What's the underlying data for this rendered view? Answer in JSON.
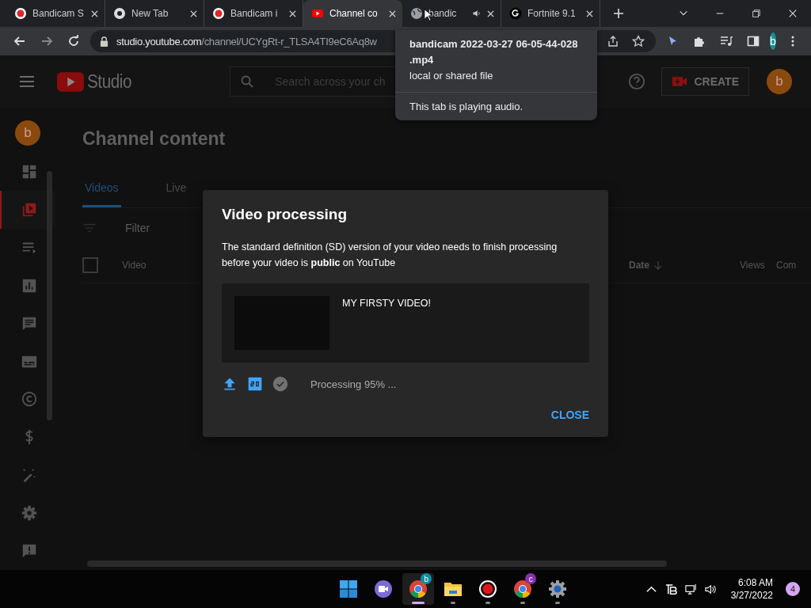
{
  "browser": {
    "tabs": [
      {
        "title": "Bandicam S",
        "kind": "record",
        "selected": false,
        "audio": false
      },
      {
        "title": "New Tab",
        "kind": "chrome",
        "selected": false,
        "audio": false
      },
      {
        "title": "Bandicam i",
        "kind": "record",
        "selected": false,
        "audio": false
      },
      {
        "title": "Channel co",
        "kind": "youtube",
        "selected": true,
        "audio": false
      },
      {
        "title": "bandic",
        "kind": "globe",
        "selected": false,
        "audio": true
      },
      {
        "title": "Fortnite 9.1",
        "kind": "letter",
        "selected": false,
        "audio": false
      }
    ],
    "address": {
      "host": "studio.youtube.com",
      "path": "/channel/UCYgRt-r_TLSA4TI9eC6Aq8w"
    },
    "profile": "b"
  },
  "tooltip": {
    "title": "bandicam 2022-03-27 06-05-44-028 .mp4",
    "subtitle": "local or shared file",
    "note": "This tab is playing audio."
  },
  "header": {
    "logo": "Studio",
    "search_placeholder": "Search across your ch",
    "create": "CREATE",
    "avatar": "b"
  },
  "sidebar": {
    "avatar": "b",
    "items": [
      {
        "kind": "dashboard",
        "selected": false
      },
      {
        "kind": "content",
        "selected": true
      },
      {
        "kind": "playlists",
        "selected": false
      },
      {
        "kind": "analytics",
        "selected": false
      },
      {
        "kind": "comments",
        "selected": false
      },
      {
        "kind": "subtitles",
        "selected": false
      },
      {
        "kind": "copyright",
        "selected": false
      },
      {
        "kind": "earn",
        "selected": false
      },
      {
        "kind": "customization",
        "selected": false
      },
      {
        "kind": "settings",
        "selected": false
      },
      {
        "kind": "feedback",
        "selected": false
      }
    ]
  },
  "content": {
    "title": "Channel content",
    "tabs": [
      {
        "label": "Videos",
        "selected": true
      },
      {
        "label": "Live",
        "selected": false
      }
    ],
    "filter": "Filter",
    "select_all": {
      "checked": false
    },
    "columns": [
      {
        "label": "Video",
        "sorted": false
      },
      {
        "label": "Date",
        "sorted": true
      },
      {
        "label": "Views",
        "sorted": false
      },
      {
        "label": "Com",
        "sorted": false
      }
    ]
  },
  "dialog": {
    "title": "Video processing",
    "message": "The standard definition (SD) version of your video needs to finish processing before your video is **public** on YouTube",
    "video_title": "MY FIRSTY VIDEO!",
    "steps": [
      {
        "kind": "upload",
        "done": true
      },
      {
        "kind": "sd",
        "done": true
      },
      {
        "kind": "check",
        "done": false
      }
    ],
    "status": "Processing 95% ...",
    "close": "CLOSE"
  },
  "taskbar": {
    "apps": [
      {
        "kind": "start",
        "selected": false,
        "running": false
      },
      {
        "kind": "meet",
        "selected": false,
        "running": false
      },
      {
        "kind": "chrome",
        "badge": "b",
        "selected": true,
        "running": true
      },
      {
        "kind": "folder",
        "selected": false,
        "running": true
      },
      {
        "kind": "record",
        "selected": false,
        "running": true
      },
      {
        "kind": "chrome",
        "badge": "c",
        "selected": false,
        "running": true
      },
      {
        "kind": "settings",
        "selected": false,
        "running": true
      }
    ],
    "time": "6:08 AM",
    "date": "3/27/2022",
    "notifications": "4"
  }
}
